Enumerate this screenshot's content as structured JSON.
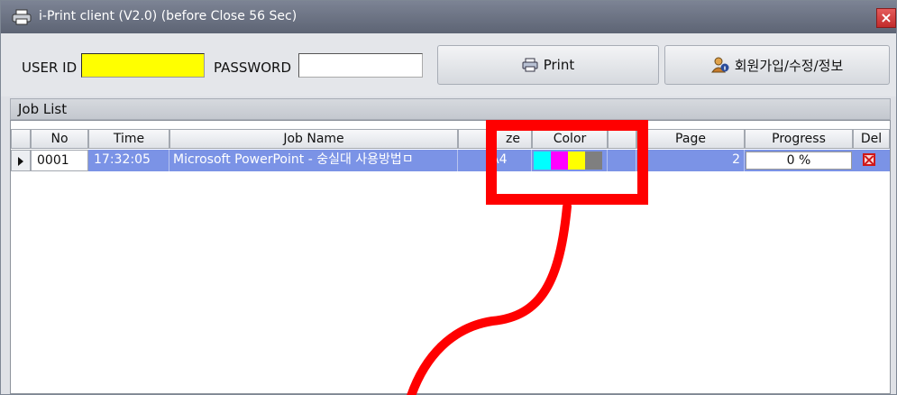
{
  "window": {
    "title": "i-Print client (V2.0) (before Close 56 Sec)"
  },
  "login": {
    "user_id_label": "USER ID",
    "user_id_value": "",
    "password_label": "PASSWORD",
    "password_value": ""
  },
  "buttons": {
    "print_label": "Print",
    "member_label": "회원가입/수정/정보"
  },
  "job_list": {
    "title": "Job List",
    "columns": [
      "No",
      "Time",
      "Job Name",
      "ze",
      "Color",
      "",
      "Page",
      "Progress",
      "Del"
    ],
    "rows": [
      {
        "no": "0001",
        "time": "17:32:05",
        "job_name": "Microsoft PowerPoint - 숭실대 사용방법ㅁ",
        "size": "A4",
        "color_swatches": [
          "#00ffff",
          "#ff00ff",
          "#ffff00",
          "#7f7f7f"
        ],
        "page": "2",
        "progress": "0 %"
      }
    ]
  },
  "colors": {
    "title_bar": "#5d6474",
    "selection": "#7b93e6",
    "annotation": "#ff0000",
    "user_id_field": "#ffff00"
  },
  "icons": {
    "title": "printer-icon",
    "print": "printer-icon",
    "member": "user-info-icon",
    "delete": "delete-x-icon",
    "close": "close-icon"
  }
}
